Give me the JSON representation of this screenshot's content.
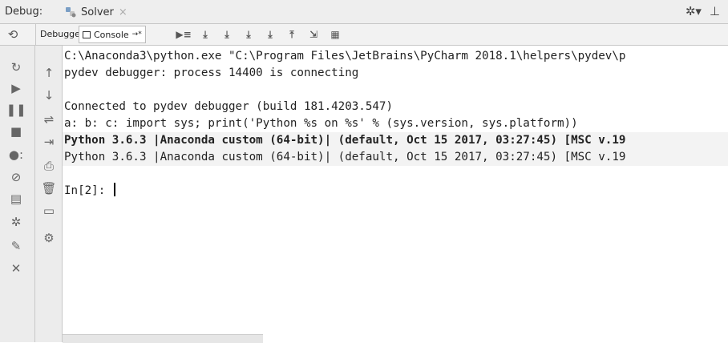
{
  "window": {
    "debug_label": "Debug:",
    "tab_title": "Solver",
    "tab_close": "×",
    "gear": "✲▾",
    "minimize": "⊥"
  },
  "toolbar": {
    "debugger_tab": "Debugger",
    "console_tab": "Console",
    "console_pin": "→*",
    "icons": [
      "show-execution-point-icon",
      "step-over-icon",
      "step-into-icon",
      "step-into-my-code-icon",
      "force-step-into-icon",
      "step-out-icon",
      "run-to-cursor-icon",
      "evaluate-expression-icon"
    ],
    "icon_glyphs": [
      "▶≡",
      "⤓",
      "⤓",
      "⤓",
      "⤓",
      "⤒",
      "⇲",
      "▦"
    ]
  },
  "sidebar1": {
    "icons": [
      "rerun-icon",
      "resume-icon",
      "pause-icon",
      "stop-icon",
      "view-breakpoints-icon",
      "mute-breakpoints-icon",
      "restore-layout-icon",
      "settings-icon",
      "pin-icon",
      "close-icon"
    ],
    "glyphs": [
      "↻",
      "▶",
      "❚❚",
      "■",
      "●:",
      "⊘",
      "▤",
      "✲",
      "✎",
      "✕"
    ]
  },
  "sidebar2": {
    "icons": [
      "up-arrow-icon",
      "down-arrow-icon",
      "soft-wrap-icon",
      "scroll-to-end-icon",
      "print-icon",
      "clear-all-icon",
      "show-console-icon",
      "settings-console-icon"
    ],
    "glyphs": [
      "↑",
      "↓",
      "⇌",
      "⇥",
      "⎙",
      "🗑",
      "▭",
      "⚙"
    ]
  },
  "console": {
    "lines": [
      {
        "text": "C:\\Anaconda3\\python.exe \"C:\\Program Files\\JetBrains\\PyCharm 2018.1\\helpers\\pydev\\p",
        "bold": false
      },
      {
        "text": "pydev debugger: process 14400 is connecting",
        "bold": false
      },
      {
        "text": "",
        "bold": false
      },
      {
        "text": "Connected to pydev debugger (build 181.4203.547)",
        "bold": false
      },
      {
        "text": "a: b: c: import sys; print('Python %s on %s' % (sys.version, sys.platform))",
        "bold": false
      },
      {
        "text": "Python 3.6.3 |Anaconda custom (64-bit)| (default, Oct 15 2017, 03:27:45) [MSC v.19",
        "bold": true
      },
      {
        "text": "Python 3.6.3 |Anaconda custom (64-bit)| (default, Oct 15 2017, 03:27:45) [MSC v.19",
        "bold": false
      },
      {
        "text": "",
        "bold": false
      },
      {
        "text": "In[2]: ",
        "bold": false
      }
    ]
  }
}
